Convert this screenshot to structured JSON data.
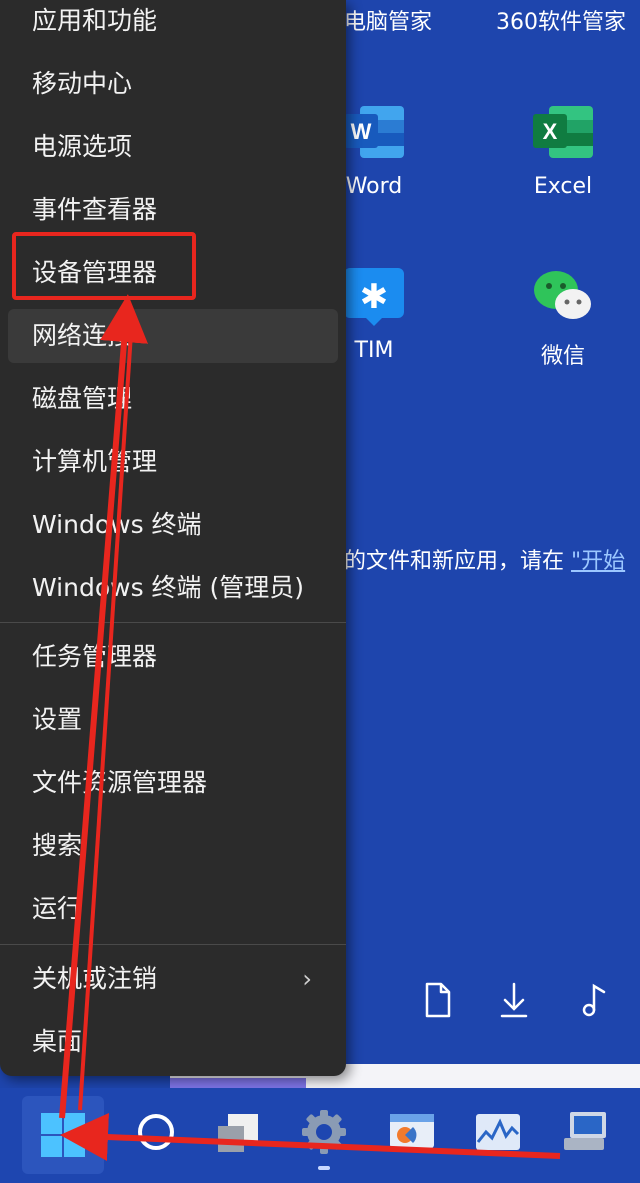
{
  "start_menu": {
    "pinned_top": [
      "电脑管家",
      "360软件管家"
    ],
    "apps": [
      {
        "label": "Word",
        "icon": "word-icon",
        "color": "#2b65c8"
      },
      {
        "label": "Excel",
        "icon": "excel-icon",
        "color": "#1d7a44"
      },
      {
        "label": "TIM",
        "icon": "tim-icon",
        "color": "#1b8cf0"
      },
      {
        "label": "微信",
        "icon": "wechat-icon",
        "color": "#2fc45a"
      }
    ],
    "recommend_text": "的文件和新应用，请在",
    "recommend_link": "\"开始",
    "quick_icons": [
      "document-icon",
      "download-icon",
      "music-icon"
    ]
  },
  "context_menu": {
    "items": [
      "应用和功能",
      "移动中心",
      "电源选项",
      "事件查看器",
      "设备管理器",
      "网络连接",
      "磁盘管理",
      "计算机管理",
      "Windows 终端",
      "Windows 终端 (管理员)",
      "任务管理器",
      "设置",
      "文件资源管理器",
      "搜索",
      "运行",
      "关机或注销",
      "桌面"
    ],
    "highlighted": "设备管理器",
    "hovered": "网络连接",
    "submenu_chevron": "›"
  },
  "taskbar": {
    "icons": [
      "windows-start-icon",
      "search-icon",
      "task-view-icon",
      "settings-icon",
      "paint-app-icon",
      "resource-monitor-icon",
      "computer-app-icon"
    ]
  },
  "colors": {
    "menu_bg": "#2b2b2b",
    "highlight": "#e8261e",
    "desktop": "#1e45ad"
  }
}
